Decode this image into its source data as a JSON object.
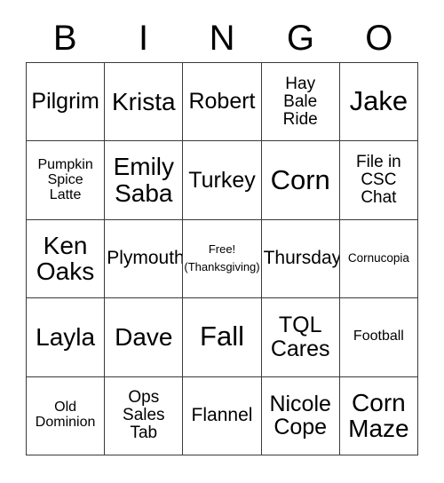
{
  "header": {
    "letters": [
      "B",
      "I",
      "N",
      "G",
      "O"
    ]
  },
  "grid": {
    "rows": [
      [
        {
          "text": "Pilgrim",
          "size": "md"
        },
        {
          "text": "Krista",
          "size": "lg"
        },
        {
          "text": "Robert",
          "size": "md"
        },
        {
          "text": "Hay\nBale\nRide",
          "size": "xs"
        },
        {
          "text": "Jake",
          "size": "xl"
        }
      ],
      [
        {
          "text": "Pumpkin\nSpice\nLatte",
          "size": "xxs"
        },
        {
          "text": "Emily\nSaba",
          "size": "lg"
        },
        {
          "text": "Turkey",
          "size": "md"
        },
        {
          "text": "Corn",
          "size": "xl"
        },
        {
          "text": "File in\nCSC\nChat",
          "size": "xs"
        }
      ],
      [
        {
          "text": "Ken\nOaks",
          "size": "lg"
        },
        {
          "text": "Plymouth",
          "size": "sm"
        },
        {
          "text": "Free!\n(Thanksgiving)",
          "size": "free"
        },
        {
          "text": "Thursday",
          "size": "sm"
        },
        {
          "text": "Cornucopia",
          "size": "tiny"
        }
      ],
      [
        {
          "text": "Layla",
          "size": "lg"
        },
        {
          "text": "Dave",
          "size": "lg"
        },
        {
          "text": "Fall",
          "size": "xl"
        },
        {
          "text": "TQL\nCares",
          "size": "md"
        },
        {
          "text": "Football",
          "size": "xxs"
        }
      ],
      [
        {
          "text": "Old\nDominion",
          "size": "xxs"
        },
        {
          "text": "Ops\nSales\nTab",
          "size": "xs"
        },
        {
          "text": "Flannel",
          "size": "sm"
        },
        {
          "text": "Nicole\nCope",
          "size": "md"
        },
        {
          "text": "Corn\nMaze",
          "size": "lg"
        }
      ]
    ],
    "free_space": {
      "line1": "Free!",
      "line2": "(Thanksgiving)"
    }
  },
  "colors": {
    "border": "#3a3a3a",
    "text": "#000000",
    "background": "#ffffff"
  }
}
